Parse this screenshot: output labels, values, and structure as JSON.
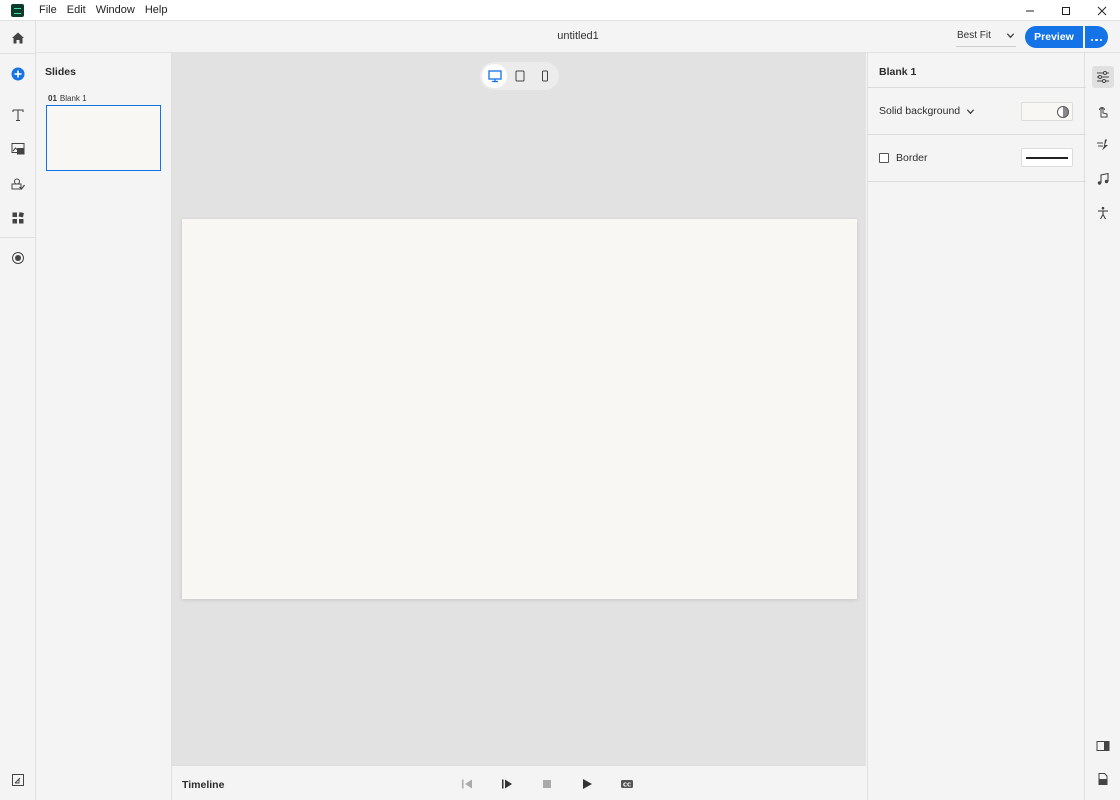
{
  "window": {
    "app_icon": "captivate-app-icon",
    "menu": [
      "File",
      "Edit",
      "Window",
      "Help"
    ],
    "controls": [
      "minimize-icon",
      "maximize-icon",
      "close-icon"
    ]
  },
  "header": {
    "doc_title": "untitled1",
    "zoom": "Best Fit",
    "preview_label": "Preview",
    "more_icon": "more-icon"
  },
  "left_toolbar": {
    "tools": [
      "home-icon",
      "add-icon",
      "text-icon",
      "media-icon",
      "interactions-icon",
      "widgets-icon",
      "record-icon",
      "panel-toggle-icon"
    ]
  },
  "slides_panel": {
    "title": "Slides",
    "slides": [
      {
        "number": "01",
        "name": "Blank 1",
        "selected": true
      }
    ]
  },
  "canvas": {
    "devices": [
      "desktop-icon",
      "tablet-icon",
      "mobile-icon"
    ],
    "active_device": "desktop",
    "slide_background": "#f8f7f3"
  },
  "timeline": {
    "title": "Timeline",
    "controls": [
      "step-back-icon",
      "step-forward-icon",
      "stop-icon",
      "play-icon",
      "closed-captions-icon"
    ]
  },
  "properties": {
    "title": "Blank 1",
    "background_mode": "Solid background",
    "border_label": "Border",
    "border_checked": false
  },
  "right_toolbar": {
    "tools": [
      "properties-icon",
      "interaction-icon",
      "animation-icon",
      "audio-icon",
      "accessibility-icon",
      "layout-panel-icon",
      "document-icon"
    ],
    "active": "properties-icon"
  },
  "colors": {
    "accent": "#1473e6",
    "slide_bg": "#f8f7f3",
    "canvas_bg": "#e2e2e2",
    "panel_bg": "#f4f4f4"
  }
}
